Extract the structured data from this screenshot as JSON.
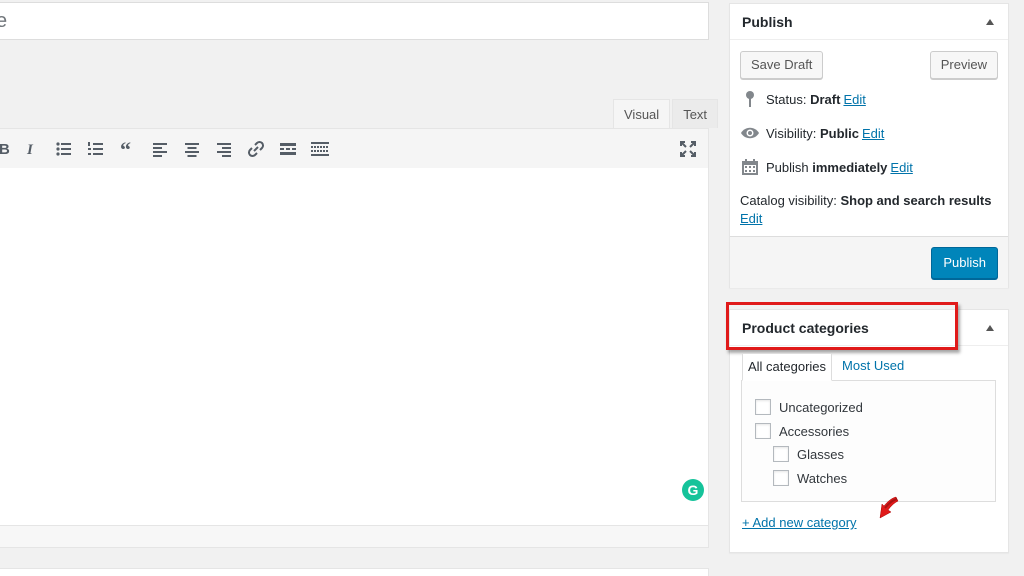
{
  "editor": {
    "title_value": "e",
    "tabs": [
      {
        "label": "Visual",
        "active": true
      },
      {
        "label": "Text",
        "active": false
      }
    ],
    "toolbar_icons": [
      "bold-icon",
      "italic-icon",
      "bulleted-list-icon",
      "numbered-list-icon",
      "blockquote-icon",
      "align-left-icon",
      "align-center-icon",
      "align-right-icon",
      "link-icon",
      "read-more-icon",
      "toolbar-toggle-icon",
      "fullscreen-icon"
    ],
    "grammarly_label": "G"
  },
  "publish": {
    "title": "Publish",
    "save_draft_label": "Save Draft",
    "preview_label": "Preview",
    "status_label": "Status:",
    "status_value": "Draft",
    "visibility_label": "Visibility:",
    "visibility_value": "Public",
    "publish_label": "Publish",
    "publish_value": "immediately",
    "catalog_label": "Catalog visibility:",
    "catalog_value": "Shop and search results",
    "edit_label": "Edit",
    "publish_button_label": "Publish"
  },
  "categories": {
    "title": "Product categories",
    "tabs": [
      "All categories",
      "Most Used"
    ],
    "items": [
      {
        "label": "Uncategorized",
        "checked": false,
        "level": 0
      },
      {
        "label": "Accessories",
        "checked": false,
        "level": 0
      },
      {
        "label": "Glasses",
        "checked": false,
        "level": 1
      },
      {
        "label": "Watches",
        "checked": false,
        "level": 1
      }
    ],
    "add_new_label": "+ Add new category"
  },
  "colors": {
    "accent": "#0073aa",
    "primary_button": "#0085ba",
    "annotation": "#e01a1a",
    "grammarly": "#15c39a"
  }
}
